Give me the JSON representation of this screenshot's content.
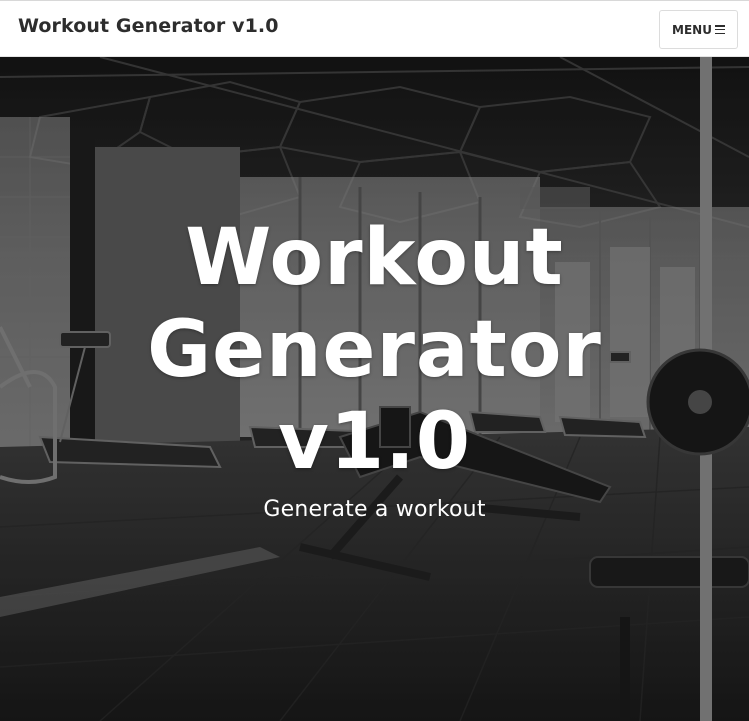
{
  "navbar": {
    "brand": "Workout Generator v1.0",
    "menu_label": "MENU"
  },
  "hero": {
    "title_lines": [
      "Workout",
      "Generator",
      "v1.0"
    ],
    "subtitle": "Generate a workout",
    "background_image": "gym interior with treadmills and weight bench (grayscale)"
  },
  "icons": {
    "menu": "bars-icon"
  },
  "colors": {
    "navbar_bg": "#ffffff",
    "brand_text": "#2d2d2d",
    "hero_text": "#ffffff"
  }
}
